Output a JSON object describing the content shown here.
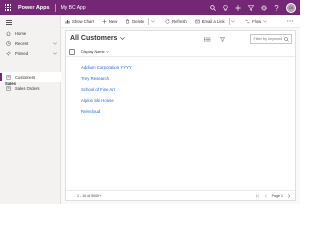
{
  "topbar": {
    "app_name": "Power Apps",
    "app_title": "My BC App",
    "avatar_initials": "CK",
    "bg_color": "#742774"
  },
  "sidebar": {
    "home": "Home",
    "recent": "Recent",
    "pinned": "Pinned",
    "group": "Sales",
    "customers": "Customers",
    "sales_orders": "Sales Orders"
  },
  "commands": {
    "show_chart": "Show Chart",
    "new": "New",
    "delete": "Delete",
    "refresh": "Refresh",
    "email_link": "Email a Link",
    "flow": "Flow"
  },
  "view": {
    "title": "All Customers",
    "search_placeholder": "Filter by keyword",
    "column_header": "Display Name",
    "rows": [
      "Addium Corporation YYYY",
      "Trey Research",
      "School of Fine Art",
      "Alpine Ski House",
      "Relecloud"
    ]
  },
  "footer": {
    "count": "1 - 10 of 5000+",
    "page_label": "Page 1"
  }
}
